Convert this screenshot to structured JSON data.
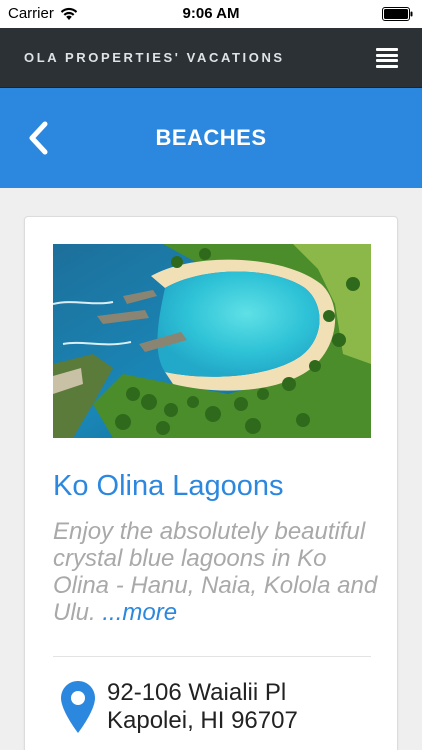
{
  "status_bar": {
    "carrier": "Carrier",
    "time": "9:06 AM"
  },
  "header": {
    "app_title": "OLA PROPERTIES' VACATIONS",
    "menu_icon": "hamburger-menu-icon"
  },
  "title_bar": {
    "title": "BEACHES",
    "back_icon": "chevron-left-icon",
    "color": "#2c88de"
  },
  "listing": {
    "title": "Ko Olina Lagoons",
    "description": "Enjoy the absolutely beautiful crystal blue lagoons in Ko Olina - Hanu, Naia, Kolola and Ulu. ",
    "more_label": "...more",
    "address_line1": "92-106 Waialii Pl",
    "address_line2": "Kapolei, HI 96707",
    "location_icon": "map-pin-icon"
  },
  "colors": {
    "header_bg": "#2b3135",
    "accent": "#2c88de",
    "muted_text": "#a9a9a9"
  }
}
